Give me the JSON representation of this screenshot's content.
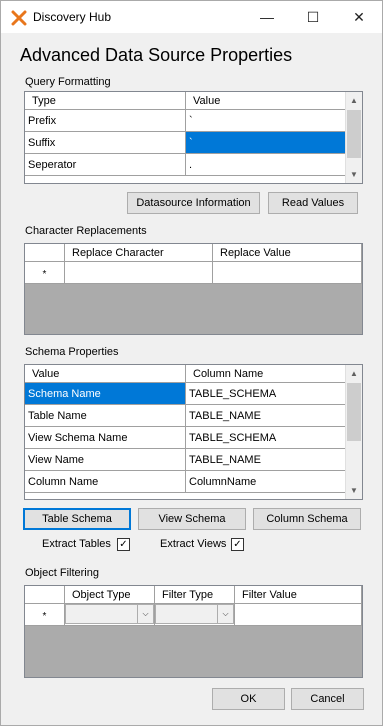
{
  "window": {
    "title": "Discovery Hub",
    "minimize_glyph": "—",
    "maximize_glyph": "☐",
    "close_glyph": "✕",
    "accent": "#e8761c"
  },
  "page_title": "Advanced Data Source Properties",
  "query_formatting": {
    "label": "Query Formatting",
    "headers": [
      "Type",
      "Value"
    ],
    "rows": [
      {
        "type": "Prefix",
        "value": "`"
      },
      {
        "type": "Suffix",
        "value": "`"
      },
      {
        "type": "Seperator",
        "value": "."
      }
    ]
  },
  "buttons": {
    "datasource_info": "Datasource Information",
    "read_values": "Read Values",
    "table_schema": "Table Schema",
    "view_schema": "View Schema",
    "column_schema": "Column Schema",
    "ok": "OK",
    "cancel": "Cancel"
  },
  "character_replacements": {
    "label": "Character Replacements",
    "headers": [
      "Replace Character",
      "Replace Value"
    ],
    "new_row_marker": "*"
  },
  "schema_properties": {
    "label": "Schema Properties",
    "headers": [
      "Value",
      "Column Name"
    ],
    "rows": [
      {
        "value": "Schema Name",
        "column": "TABLE_SCHEMA"
      },
      {
        "value": "Table Name",
        "column": "TABLE_NAME"
      },
      {
        "value": "View Schema Name",
        "column": "TABLE_SCHEMA"
      },
      {
        "value": "View Name",
        "column": "TABLE_NAME"
      },
      {
        "value": "Column Name",
        "column": "ColumnName"
      }
    ]
  },
  "extract": {
    "tables_label": "Extract Tables",
    "tables_checked": true,
    "views_label": "Extract Views",
    "views_checked": true,
    "check_glyph": "✓"
  },
  "object_filtering": {
    "label": "Object Filtering",
    "headers": [
      "Object Type",
      "Filter Type",
      "Filter Value"
    ],
    "new_row_marker": "*"
  },
  "scroll_arrows": {
    "up": "▲",
    "down": "▼",
    "combo": "⌵"
  }
}
